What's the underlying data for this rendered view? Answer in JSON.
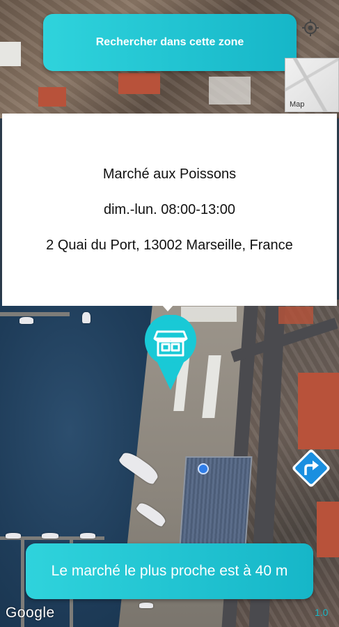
{
  "search_area_button": {
    "label": "Rechercher dans cette zone"
  },
  "map_type_toggle": {
    "label": "Map"
  },
  "market": {
    "name": "Marché aux Poissons",
    "hours": "dim.-lun. 08:00-13:00",
    "address": "2 Quai du Port, 13002 Marseille, France"
  },
  "nearest_banner": {
    "text": "Le marché le plus proche est à 40 m"
  },
  "attribution": {
    "logo_text": "Google"
  },
  "version": {
    "text": "1.0"
  },
  "icons": {
    "locate": "my-location-icon",
    "marker": "market-stall-icon",
    "directions": "directions-arrow-icon"
  },
  "colors": {
    "accent": "#1fc4d3",
    "user_location": "#2f7de8",
    "directions": "#1a8fe0"
  }
}
